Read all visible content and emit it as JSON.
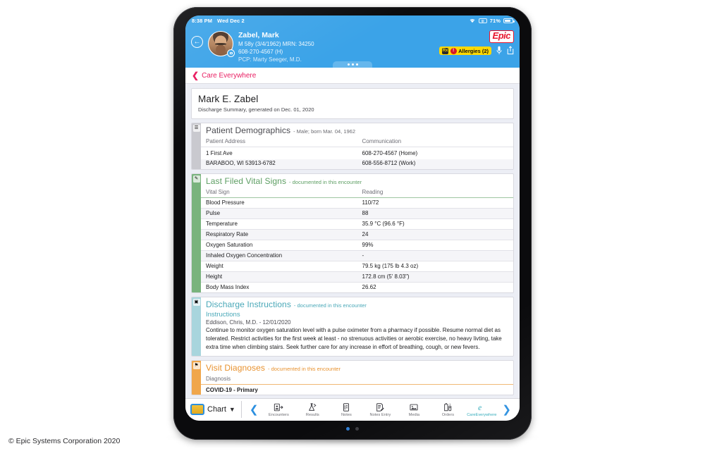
{
  "status_bar": {
    "time": "8:38 PM",
    "date": "Wed Dec 2",
    "wifi_icon": "wifi-icon",
    "lock_icon": "rotation-lock-icon",
    "battery_percent": "71%",
    "battery_icon": "battery-icon"
  },
  "patient_header": {
    "back_icon": "back-arrow-icon",
    "avatar_icon": "patient-photo-avatar",
    "camera_badge_icon": "camera-icon",
    "name": "Zabel, Mark",
    "demographics_line": "M 58y (3/4/1962) MRN: 34250",
    "phone_line": "608-270-4567 (H)",
    "pcp_line": "PCP: Marty Seeger, M.D.",
    "brand": "Epic",
    "allergies_label": "Allergies (2)",
    "allergy_icon_1": "allergy-drug-icon",
    "allergy_icon_2": "allergy-warning-icon",
    "mic_icon": "microphone-icon",
    "share_icon": "share-icon",
    "drag_handle_icon": "drag-handle-icon"
  },
  "breadcrumb": {
    "back_icon": "chevron-left-icon",
    "label": "Care Everywhere"
  },
  "document": {
    "title": "Mark E. Zabel",
    "subtitle": "Discharge Summary, generated on Dec. 01, 2020"
  },
  "demographics": {
    "accent_color": "#c9c9cf",
    "icon": "demographics-icon",
    "title": "Patient Demographics",
    "note": "- Male; born Mar. 04, 1962",
    "columns": [
      "Patient Address",
      "Communication"
    ],
    "rows": [
      [
        "1 First Ave",
        "608-270-4567 (Home)"
      ],
      [
        "BARABOO, WI 53913-6782",
        "608-556-8712 (Work)"
      ]
    ]
  },
  "vitals": {
    "accent_color": "#79b37d",
    "icon": "vitals-icon",
    "title": "Last Filed Vital Signs",
    "note": "- documented in this encounter",
    "columns": [
      "Vital Sign",
      "Reading"
    ],
    "rows": [
      [
        "Blood Pressure",
        "110/72"
      ],
      [
        "Pulse",
        "88"
      ],
      [
        "Temperature",
        "35.9 °C (96.6 °F)"
      ],
      [
        "Respiratory Rate",
        "24"
      ],
      [
        "Oxygen Saturation",
        "99%"
      ],
      [
        "Inhaled Oxygen Concentration",
        "-"
      ],
      [
        "Weight",
        "79.5 kg (175 lb 4.3 oz)"
      ],
      [
        "Height",
        "172.8 cm (5' 8.03\")"
      ],
      [
        "Body Mass Index",
        "26.62"
      ]
    ]
  },
  "discharge_instructions": {
    "accent_color": "#a8d5dd",
    "icon": "instructions-icon",
    "title": "Discharge Instructions",
    "note": "- documented in this encounter",
    "label": "Instructions",
    "author": "Eddison, Chris, M.D. - 12/01/2020",
    "body": "Continue to monitor oxygen saturation level with a pulse oximeter from a pharmacy if possible. Resume normal diet as tolerated. Restrict activities for the first week at least - no strenuous activities or aerobic exercise, no heavy livting, take extra time when climbing stairs. Seek further care for any increase in effort of breathing, cough, or new fevers."
  },
  "diagnoses": {
    "accent_color": "#f0a64b",
    "icon": "diagnoses-icon",
    "title": "Visit Diagnoses",
    "note": "- documented in this encounter",
    "columns": [
      "Diagnosis"
    ],
    "rows": [
      [
        "COVID-19 - Primary"
      ]
    ]
  },
  "toolbar": {
    "folder_icon": "chart-folder-icon",
    "chart_label": "Chart",
    "caret_icon": "chevron-down-icon",
    "prev_icon": "chevron-left-icon",
    "next_icon": "chevron-right-icon",
    "items": [
      {
        "label": "Encounters",
        "icon": "encounters-icon",
        "active": false
      },
      {
        "label": "Results",
        "icon": "results-flask-icon",
        "active": false
      },
      {
        "label": "Notes",
        "icon": "notes-icon",
        "active": false
      },
      {
        "label": "Notes Entry",
        "icon": "notes-entry-icon",
        "active": false
      },
      {
        "label": "Media",
        "icon": "media-image-icon",
        "active": false
      },
      {
        "label": "Orders",
        "icon": "orders-icon",
        "active": false
      },
      {
        "label": "CareEverywhere",
        "icon": "care-everywhere-icon",
        "active": true
      }
    ]
  },
  "page_dots": {
    "active_index": 0,
    "count": 2
  },
  "copyright": "© Epic Systems Corporation 2020"
}
